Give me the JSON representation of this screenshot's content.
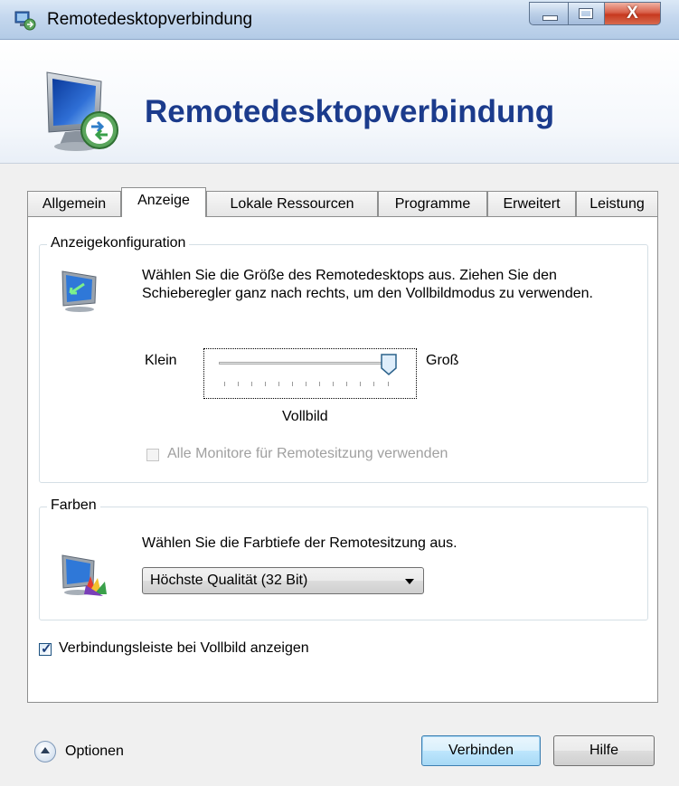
{
  "window": {
    "title": "Remotedesktopverbindung",
    "close_glyph": "X"
  },
  "header": {
    "title": "Remotedesktopverbindung"
  },
  "tabs": [
    {
      "label": "Allgemein",
      "active": false
    },
    {
      "label": "Anzeige",
      "active": true
    },
    {
      "label": "Lokale Ressourcen",
      "active": false
    },
    {
      "label": "Programme",
      "active": false
    },
    {
      "label": "Erweitert",
      "active": false
    },
    {
      "label": "Leistung",
      "active": false
    }
  ],
  "display_config": {
    "group_title": "Anzeigekonfiguration",
    "description": "Wählen Sie die Größe des Remotedesktops aus. Ziehen Sie den Schieberegler ganz nach rechts, um den Vollbildmodus zu verwenden.",
    "slider": {
      "min_label": "Klein",
      "max_label": "Groß",
      "value_label": "Vollbild",
      "position_fraction": 1.0
    },
    "all_monitors": {
      "label": "Alle Monitore für Remotesitzung verwenden",
      "checked": false,
      "enabled": false
    }
  },
  "colors": {
    "group_title": "Farben",
    "description": "Wählen Sie die Farbtiefe der Remotesitzung aus.",
    "select": {
      "value": "Höchste Qualität (32 Bit)"
    }
  },
  "connection_bar": {
    "label": "Verbindungsleiste bei Vollbild anzeigen",
    "checked": true
  },
  "footer": {
    "options_label": "Optionen",
    "connect_label": "Verbinden",
    "help_label": "Hilfe"
  },
  "theme": {
    "header_title_color": "#1b3b8c",
    "default_button_color": "#bee6fd",
    "close_button_color": "#c7391f"
  },
  "icons": [
    "app-icon",
    "rdp-computer-icon",
    "display-monitor-icon",
    "color-palette-icon",
    "chevron-up-icon"
  ]
}
